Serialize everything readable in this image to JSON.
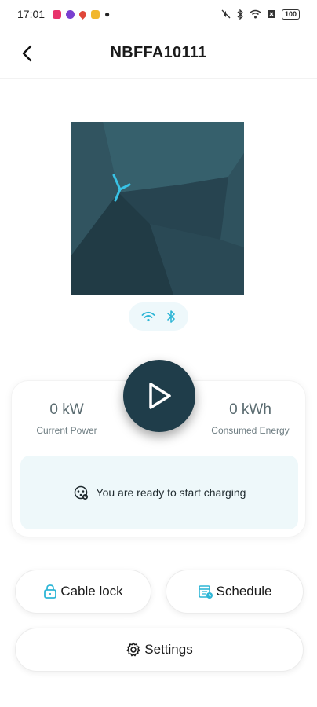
{
  "status_bar": {
    "time": "17:01",
    "battery": "100"
  },
  "header": {
    "title": "NBFFA10111"
  },
  "metrics": {
    "power_value": "0 kW",
    "power_label": "Current Power",
    "energy_value": "0 kWh",
    "energy_label": "Consumed Energy"
  },
  "ready_message": "You are ready to start charging",
  "actions": {
    "cable_lock": "Cable lock",
    "schedule": "Schedule",
    "settings": "Settings"
  },
  "icons": {
    "back": "back-arrow-icon",
    "wifi": "wifi-icon",
    "bluetooth": "bluetooth-icon",
    "play": "play-icon",
    "ready": "charger-ready-icon",
    "cable_lock": "lock-icon",
    "schedule": "calendar-icon",
    "settings": "gear-icon"
  },
  "colors": {
    "accent": "#2fb6d6",
    "dark_teal": "#1f3d4a",
    "ready_bg": "#eef8fa"
  }
}
